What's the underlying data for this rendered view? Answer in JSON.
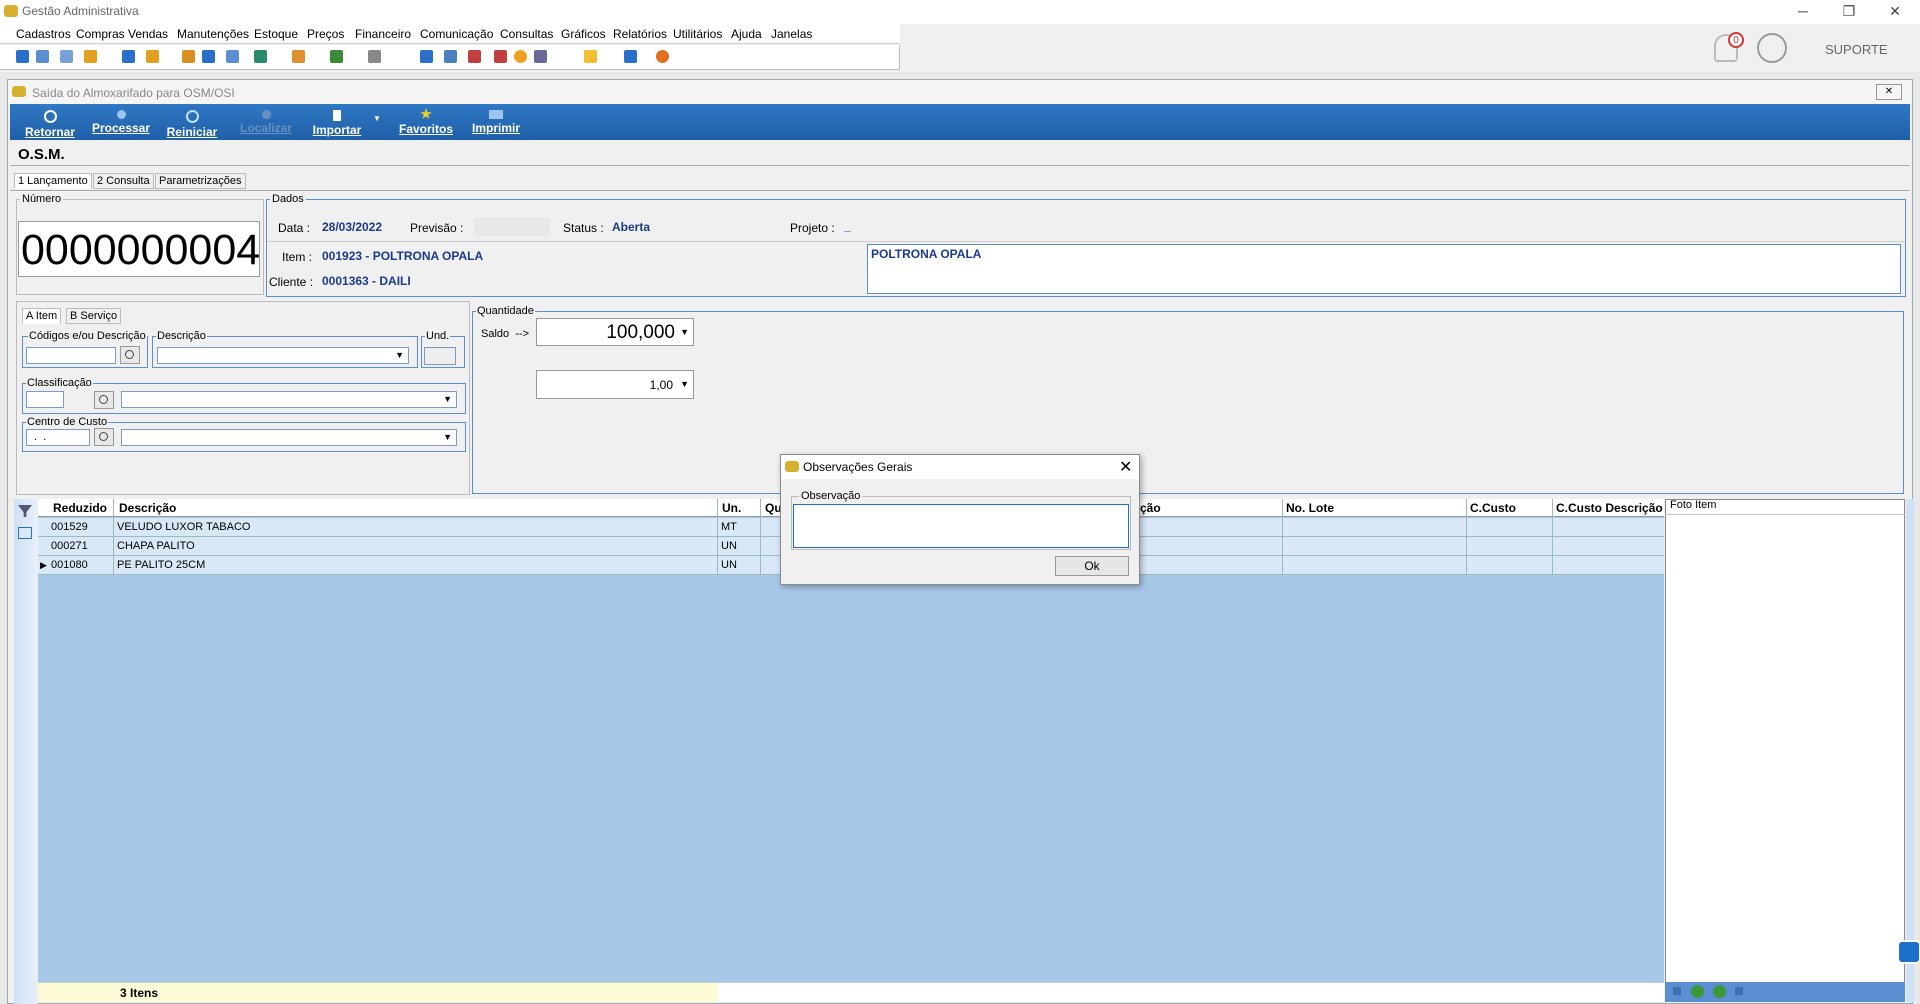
{
  "app": {
    "title": "Gestão Administrativa",
    "user": "SUPORTE",
    "notif_count": "0"
  },
  "menu": [
    "Cadastros",
    "Compras",
    "Vendas",
    "Manutenções",
    "Estoque",
    "Preços",
    "Financeiro",
    "Comunicação",
    "Consultas",
    "Gráficos",
    "Relatórios",
    "Utilitários",
    "Ajuda",
    "Janelas"
  ],
  "window": {
    "title": "Saída do Almoxarifado para OSM/OSI",
    "close": "✕"
  },
  "ribbon": [
    "Retornar",
    "Processar",
    "Reiniciar",
    "Localizar",
    "Importar",
    "Favoritos",
    "Imprimir"
  ],
  "section": "O.S.M.",
  "tabs": [
    "1 Lançamento",
    "2 Consulta",
    "Parametrizações"
  ],
  "numero": {
    "label": "Número",
    "value": "0000000004"
  },
  "dados": {
    "label": "Dados",
    "data_label": "Data  :",
    "data_value": "28/03/2022",
    "previsao_label": "Previsão :",
    "status_label": "Status :",
    "status_value": "Aberta",
    "projeto_label": "Projeto :",
    "projeto_value": "_",
    "item_label": "Item  :",
    "item_value": "001923 - POLTRONA OPALA",
    "cliente_label": "Cliente  :",
    "cliente_value": "0001363 - DAILI",
    "desc_box": "POLTRONA OPALA"
  },
  "subtabs": [
    "A Item",
    "B Serviço"
  ],
  "fields": {
    "codigos": "Códigos e/ou Descrição",
    "descricao": "Descrição",
    "und": "Und.",
    "classificacao": "Classificação",
    "centro": "Centro de Custo",
    "centro_value": " .  ."
  },
  "quantidade": {
    "label": "Quantidade",
    "saldo": "Saldo  -->",
    "value": "100,000",
    "qty": "1,00"
  },
  "grid": {
    "headers": [
      "Reduzido",
      "Descrição",
      "Un.",
      "Qu",
      "ção",
      "No. Lote",
      "C.Custo",
      "C.Custo Descrição"
    ],
    "rows": [
      {
        "cod": "001529",
        "desc": "VELUDO LUXOR TABACO",
        "un": "MT"
      },
      {
        "cod": "000271",
        "desc": "CHAPA PALITO",
        "un": "UN"
      },
      {
        "cod": "001080",
        "desc": "PE PALITO 25CM",
        "un": "UN"
      }
    ],
    "footer": "3 Itens"
  },
  "foto": "Foto Item",
  "dialog": {
    "title": "Observações Gerais",
    "group": "Observação",
    "ok": "Ok"
  }
}
